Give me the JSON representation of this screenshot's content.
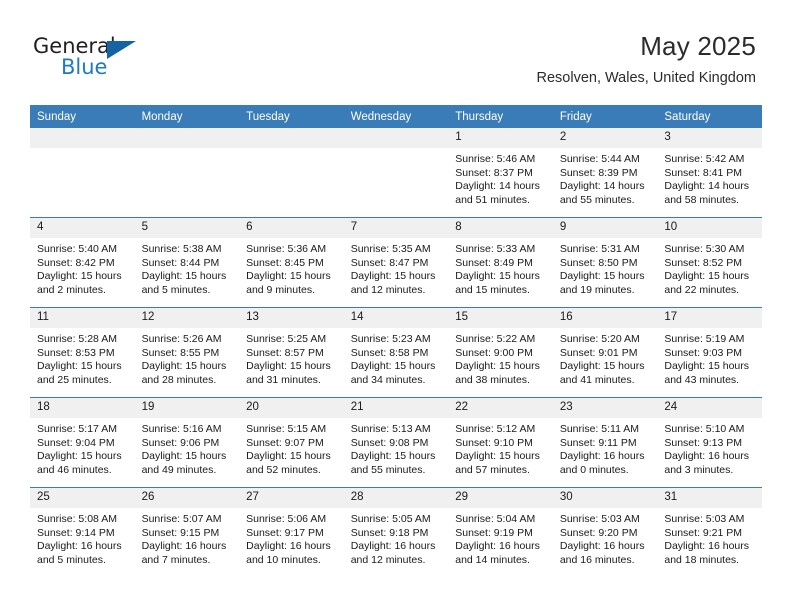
{
  "logo": {
    "word_one": "General",
    "word_two": "Blue",
    "triangle_color": "#1464a5",
    "blue_color": "#1f7bc1"
  },
  "header": {
    "month_title": "May 2025",
    "location": "Resolven, Wales, United Kingdom"
  },
  "theme": {
    "header_bg": "#3a7cb8",
    "daynum_bg": "#f0f0f0",
    "grid_line": "#3a7cb8",
    "text": "#1a1a1a"
  },
  "calendar": {
    "weekday_headers": [
      "Sunday",
      "Monday",
      "Tuesday",
      "Wednesday",
      "Thursday",
      "Friday",
      "Saturday"
    ],
    "labels": {
      "sunrise": "Sunrise:",
      "sunset": "Sunset:",
      "daylight": "Daylight:"
    },
    "weeks": [
      [
        {
          "empty": true
        },
        {
          "empty": true
        },
        {
          "empty": true
        },
        {
          "empty": true
        },
        {
          "day": "1",
          "sunrise": "Sunrise: 5:46 AM",
          "sunset": "Sunset: 8:37 PM",
          "daylight_1": "Daylight: 14 hours",
          "daylight_2": "and 51 minutes."
        },
        {
          "day": "2",
          "sunrise": "Sunrise: 5:44 AM",
          "sunset": "Sunset: 8:39 PM",
          "daylight_1": "Daylight: 14 hours",
          "daylight_2": "and 55 minutes."
        },
        {
          "day": "3",
          "sunrise": "Sunrise: 5:42 AM",
          "sunset": "Sunset: 8:41 PM",
          "daylight_1": "Daylight: 14 hours",
          "daylight_2": "and 58 minutes."
        }
      ],
      [
        {
          "day": "4",
          "sunrise": "Sunrise: 5:40 AM",
          "sunset": "Sunset: 8:42 PM",
          "daylight_1": "Daylight: 15 hours",
          "daylight_2": "and 2 minutes."
        },
        {
          "day": "5",
          "sunrise": "Sunrise: 5:38 AM",
          "sunset": "Sunset: 8:44 PM",
          "daylight_1": "Daylight: 15 hours",
          "daylight_2": "and 5 minutes."
        },
        {
          "day": "6",
          "sunrise": "Sunrise: 5:36 AM",
          "sunset": "Sunset: 8:45 PM",
          "daylight_1": "Daylight: 15 hours",
          "daylight_2": "and 9 minutes."
        },
        {
          "day": "7",
          "sunrise": "Sunrise: 5:35 AM",
          "sunset": "Sunset: 8:47 PM",
          "daylight_1": "Daylight: 15 hours",
          "daylight_2": "and 12 minutes."
        },
        {
          "day": "8",
          "sunrise": "Sunrise: 5:33 AM",
          "sunset": "Sunset: 8:49 PM",
          "daylight_1": "Daylight: 15 hours",
          "daylight_2": "and 15 minutes."
        },
        {
          "day": "9",
          "sunrise": "Sunrise: 5:31 AM",
          "sunset": "Sunset: 8:50 PM",
          "daylight_1": "Daylight: 15 hours",
          "daylight_2": "and 19 minutes."
        },
        {
          "day": "10",
          "sunrise": "Sunrise: 5:30 AM",
          "sunset": "Sunset: 8:52 PM",
          "daylight_1": "Daylight: 15 hours",
          "daylight_2": "and 22 minutes."
        }
      ],
      [
        {
          "day": "11",
          "sunrise": "Sunrise: 5:28 AM",
          "sunset": "Sunset: 8:53 PM",
          "daylight_1": "Daylight: 15 hours",
          "daylight_2": "and 25 minutes."
        },
        {
          "day": "12",
          "sunrise": "Sunrise: 5:26 AM",
          "sunset": "Sunset: 8:55 PM",
          "daylight_1": "Daylight: 15 hours",
          "daylight_2": "and 28 minutes."
        },
        {
          "day": "13",
          "sunrise": "Sunrise: 5:25 AM",
          "sunset": "Sunset: 8:57 PM",
          "daylight_1": "Daylight: 15 hours",
          "daylight_2": "and 31 minutes."
        },
        {
          "day": "14",
          "sunrise": "Sunrise: 5:23 AM",
          "sunset": "Sunset: 8:58 PM",
          "daylight_1": "Daylight: 15 hours",
          "daylight_2": "and 34 minutes."
        },
        {
          "day": "15",
          "sunrise": "Sunrise: 5:22 AM",
          "sunset": "Sunset: 9:00 PM",
          "daylight_1": "Daylight: 15 hours",
          "daylight_2": "and 38 minutes."
        },
        {
          "day": "16",
          "sunrise": "Sunrise: 5:20 AM",
          "sunset": "Sunset: 9:01 PM",
          "daylight_1": "Daylight: 15 hours",
          "daylight_2": "and 41 minutes."
        },
        {
          "day": "17",
          "sunrise": "Sunrise: 5:19 AM",
          "sunset": "Sunset: 9:03 PM",
          "daylight_1": "Daylight: 15 hours",
          "daylight_2": "and 43 minutes."
        }
      ],
      [
        {
          "day": "18",
          "sunrise": "Sunrise: 5:17 AM",
          "sunset": "Sunset: 9:04 PM",
          "daylight_1": "Daylight: 15 hours",
          "daylight_2": "and 46 minutes."
        },
        {
          "day": "19",
          "sunrise": "Sunrise: 5:16 AM",
          "sunset": "Sunset: 9:06 PM",
          "daylight_1": "Daylight: 15 hours",
          "daylight_2": "and 49 minutes."
        },
        {
          "day": "20",
          "sunrise": "Sunrise: 5:15 AM",
          "sunset": "Sunset: 9:07 PM",
          "daylight_1": "Daylight: 15 hours",
          "daylight_2": "and 52 minutes."
        },
        {
          "day": "21",
          "sunrise": "Sunrise: 5:13 AM",
          "sunset": "Sunset: 9:08 PM",
          "daylight_1": "Daylight: 15 hours",
          "daylight_2": "and 55 minutes."
        },
        {
          "day": "22",
          "sunrise": "Sunrise: 5:12 AM",
          "sunset": "Sunset: 9:10 PM",
          "daylight_1": "Daylight: 15 hours",
          "daylight_2": "and 57 minutes."
        },
        {
          "day": "23",
          "sunrise": "Sunrise: 5:11 AM",
          "sunset": "Sunset: 9:11 PM",
          "daylight_1": "Daylight: 16 hours",
          "daylight_2": "and 0 minutes."
        },
        {
          "day": "24",
          "sunrise": "Sunrise: 5:10 AM",
          "sunset": "Sunset: 9:13 PM",
          "daylight_1": "Daylight: 16 hours",
          "daylight_2": "and 3 minutes."
        }
      ],
      [
        {
          "day": "25",
          "sunrise": "Sunrise: 5:08 AM",
          "sunset": "Sunset: 9:14 PM",
          "daylight_1": "Daylight: 16 hours",
          "daylight_2": "and 5 minutes."
        },
        {
          "day": "26",
          "sunrise": "Sunrise: 5:07 AM",
          "sunset": "Sunset: 9:15 PM",
          "daylight_1": "Daylight: 16 hours",
          "daylight_2": "and 7 minutes."
        },
        {
          "day": "27",
          "sunrise": "Sunrise: 5:06 AM",
          "sunset": "Sunset: 9:17 PM",
          "daylight_1": "Daylight: 16 hours",
          "daylight_2": "and 10 minutes."
        },
        {
          "day": "28",
          "sunrise": "Sunrise: 5:05 AM",
          "sunset": "Sunset: 9:18 PM",
          "daylight_1": "Daylight: 16 hours",
          "daylight_2": "and 12 minutes."
        },
        {
          "day": "29",
          "sunrise": "Sunrise: 5:04 AM",
          "sunset": "Sunset: 9:19 PM",
          "daylight_1": "Daylight: 16 hours",
          "daylight_2": "and 14 minutes."
        },
        {
          "day": "30",
          "sunrise": "Sunrise: 5:03 AM",
          "sunset": "Sunset: 9:20 PM",
          "daylight_1": "Daylight: 16 hours",
          "daylight_2": "and 16 minutes."
        },
        {
          "day": "31",
          "sunrise": "Sunrise: 5:03 AM",
          "sunset": "Sunset: 9:21 PM",
          "daylight_1": "Daylight: 16 hours",
          "daylight_2": "and 18 minutes."
        }
      ]
    ]
  }
}
